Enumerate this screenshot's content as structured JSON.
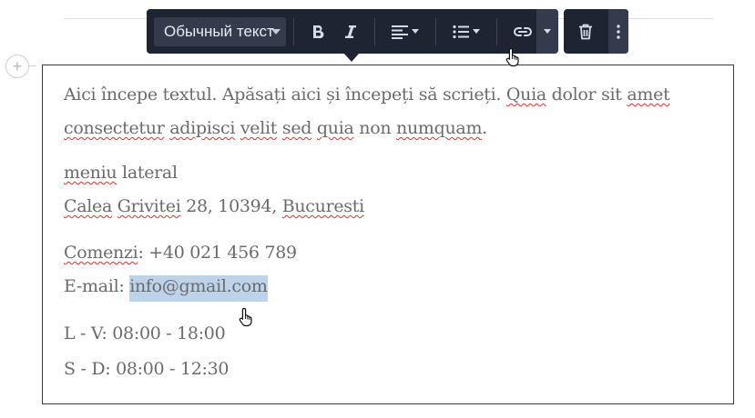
{
  "toolbar": {
    "style_select": "Обычный текст",
    "buttons": {
      "bold": "bold-icon",
      "italic": "italic-icon",
      "align": "align-left-icon",
      "list": "bulleted-list-icon",
      "link": "link-icon",
      "delete": "trash-icon",
      "more": "vertical-dots-icon"
    }
  },
  "add_block": "+",
  "content": {
    "p1": {
      "line1": {
        "a": "Aici începe textul. Apăsați aici și începeți să scrieți. ",
        "quia": "Quia",
        "b": " dolor sit ",
        "amet": "amet"
      },
      "line2": {
        "consectetur": "consectetur",
        "s1": " ",
        "adipisci": "adipisci",
        "s2": " ",
        "velit": "velit",
        "s3": " ",
        "sed": "sed",
        "s4": " ",
        "quia": "quia",
        "mid": " non ",
        "numquam": "numquam",
        "end": "."
      }
    },
    "p2": {
      "meniu": "meniu",
      "lateral": " lateral",
      "calea": "Calea",
      "s1": " ",
      "grivitei": "Grivitei",
      "addr": " 28, 10394, ",
      "bucuresti": "Bucuresti"
    },
    "p3": {
      "comenzi": "Comenzi",
      "phone": ": +40 021 456 789",
      "email_label": "E-mail: ",
      "email": "info@gmail.com"
    },
    "p4": {
      "line1": "L - V: 08:00 - 18:00",
      "line2": "S - D: 08:00 - 12:30"
    }
  },
  "colors": {
    "toolbar_bg": "#1f2432",
    "toolbar_select_bg": "#343b4d",
    "text": "#6b6b6b",
    "selection": "#bcd3ea",
    "spellcheck": "#e0352b"
  }
}
